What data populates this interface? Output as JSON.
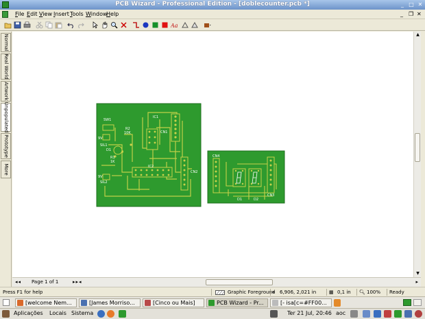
{
  "window": {
    "title": "PCB Wizard - Professional Edition - [doblecounter.pcb *]",
    "minimize": "_",
    "maximize": "□",
    "close": "✕"
  },
  "menu": [
    "File",
    "Edit",
    "View",
    "Insert",
    "Tools",
    "Window",
    "Help"
  ],
  "menu_right": {
    "minimize": "_",
    "restore": "❐",
    "close": "✕"
  },
  "toolbar_icons": [
    "open-icon",
    "save-icon",
    "print-icon",
    "cut-icon",
    "copy-icon",
    "paste-icon",
    "undo-icon",
    "redo-icon",
    "pointer-icon",
    "pan-hand-icon",
    "zoom-icon",
    "delete-icon",
    "wire-icon",
    "pad-icon",
    "pad-square-icon",
    "component-icon",
    "text-icon",
    "label-icon",
    "measure-icon",
    "rotate-icon",
    "print-dropdown-icon"
  ],
  "left_tabs": [
    "Normal",
    "Real World",
    "Artwork",
    "Unpopulated",
    "Prototype",
    "More"
  ],
  "page": {
    "label": "Page 1 of 1"
  },
  "statusbar": {
    "help": "Press F1 for help",
    "layer": "Graphic Foreground",
    "coords": "6,906, 2,021 in",
    "grid": "0,1 in",
    "zoom": "100%",
    "state": "Ready"
  },
  "board1": {
    "labels": [
      "SW1",
      "9V",
      "SIL1",
      "R1",
      "1K",
      "R2",
      "10K",
      "IC1",
      "D1",
      "IC2",
      "CN1",
      "CN2",
      "9V",
      "SIL2"
    ]
  },
  "board2": {
    "labels": [
      "CN4",
      "D1",
      "D2",
      "CN3"
    ]
  },
  "taskbar": [
    {
      "label": "[welcome Nem...",
      "active": false
    },
    {
      "label": "[James Morriso...",
      "active": false
    },
    {
      "label": "[Cinco ou Mais]",
      "active": false
    },
    {
      "label": "PCB Wizard - Pr...",
      "active": true
    },
    {
      "label": "[- isa[c=#FF00...",
      "active": false
    }
  ],
  "panel": {
    "menus": [
      "Aplicações",
      "Locais",
      "Sistema"
    ],
    "clock": "Ter 21 Jul, 20:46",
    "user": "aoc"
  },
  "colors": {
    "board": "#2e9a2e",
    "trace": "#c8d24a",
    "titlebar": "#7ea4d6"
  }
}
